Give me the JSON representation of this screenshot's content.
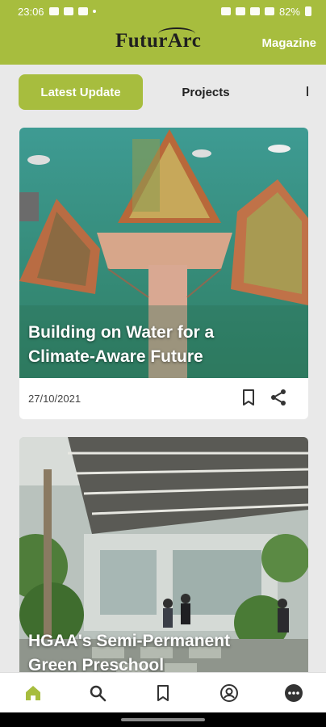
{
  "status_bar": {
    "time": "23:06",
    "battery": "82%"
  },
  "app_bar": {
    "logo": "FuturArc",
    "magazine_link": "Magazine"
  },
  "tabs": [
    {
      "label": "Latest Update",
      "active": true
    },
    {
      "label": "Projects",
      "active": false
    }
  ],
  "articles": [
    {
      "title": "Building on Water for a Climate-Aware Future",
      "date": "27/10/2021"
    },
    {
      "title": "HGAA's Semi-Permanent Green Preschool"
    }
  ],
  "bottom_nav": [
    {
      "icon": "home-icon",
      "active": true
    },
    {
      "icon": "search-icon"
    },
    {
      "icon": "bookmark-icon"
    },
    {
      "icon": "profile-icon"
    },
    {
      "icon": "more-icon"
    }
  ],
  "colors": {
    "accent": "#a7bd3e",
    "background": "#e9e9e9"
  }
}
